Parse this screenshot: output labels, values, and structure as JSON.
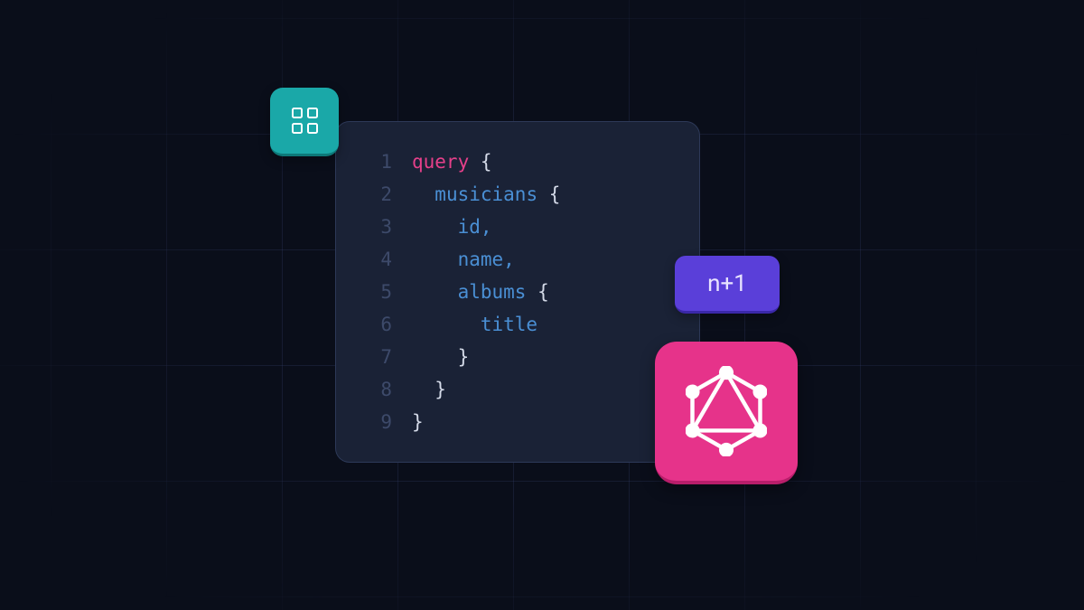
{
  "code": {
    "lines": [
      {
        "n": "1",
        "tokens": [
          {
            "t": "kw",
            "v": "query"
          },
          {
            "t": "brace",
            "v": " {"
          }
        ]
      },
      {
        "n": "2",
        "tokens": [
          {
            "t": "space",
            "v": "  "
          },
          {
            "t": "field",
            "v": "musicians"
          },
          {
            "t": "brace",
            "v": " {"
          }
        ]
      },
      {
        "n": "3",
        "tokens": [
          {
            "t": "space",
            "v": "    "
          },
          {
            "t": "field",
            "v": "id"
          },
          {
            "t": "comma",
            "v": ","
          }
        ]
      },
      {
        "n": "4",
        "tokens": [
          {
            "t": "space",
            "v": "    "
          },
          {
            "t": "field",
            "v": "name"
          },
          {
            "t": "comma",
            "v": ","
          }
        ]
      },
      {
        "n": "5",
        "tokens": [
          {
            "t": "space",
            "v": "    "
          },
          {
            "t": "field",
            "v": "albums"
          },
          {
            "t": "brace",
            "v": " {"
          }
        ]
      },
      {
        "n": "6",
        "tokens": [
          {
            "t": "space",
            "v": "      "
          },
          {
            "t": "field",
            "v": "title"
          }
        ]
      },
      {
        "n": "7",
        "tokens": [
          {
            "t": "space",
            "v": "    "
          },
          {
            "t": "brace",
            "v": "}"
          }
        ]
      },
      {
        "n": "8",
        "tokens": [
          {
            "t": "space",
            "v": "  "
          },
          {
            "t": "brace",
            "v": "}"
          }
        ]
      },
      {
        "n": "9",
        "tokens": [
          {
            "t": "brace",
            "v": "}"
          }
        ]
      }
    ]
  },
  "badges": {
    "n1_label": "n+1"
  },
  "icons": {
    "dashboard": "dashboard-icon",
    "graphql": "graphql-icon"
  },
  "colors": {
    "bg": "#0a0e1a",
    "card": "#1a2236",
    "teal": "#1aa8a8",
    "purple": "#5a3fd9",
    "pink": "#e6338a",
    "keyword": "#e6408a",
    "field": "#4a8fd4",
    "brace": "#d4dae8",
    "lineNumber": "#3d4a6a"
  }
}
